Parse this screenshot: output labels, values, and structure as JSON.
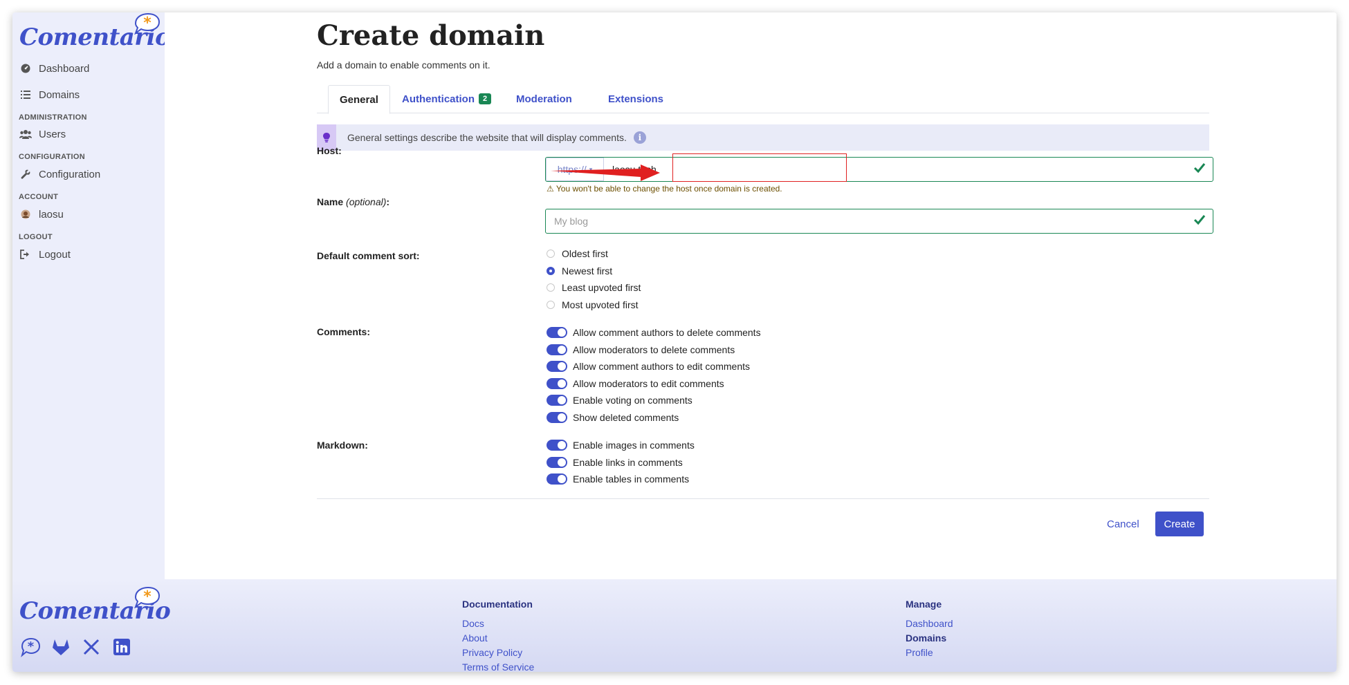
{
  "brand": {
    "name": "Comentario"
  },
  "sidebar": {
    "items": [
      {
        "label": "Dashboard",
        "icon": "dashboard-icon"
      },
      {
        "label": "Domains",
        "icon": "list-icon"
      }
    ],
    "sections": [
      {
        "title": "ADMINISTRATION",
        "items": [
          {
            "label": "Users",
            "icon": "users-icon"
          }
        ]
      },
      {
        "title": "CONFIGURATION",
        "items": [
          {
            "label": "Configuration",
            "icon": "wrench-icon"
          }
        ]
      },
      {
        "title": "ACCOUNT",
        "items": [
          {
            "label": "laosu",
            "icon": "avatar"
          }
        ]
      },
      {
        "title": "LOGOUT",
        "items": [
          {
            "label": "Logout",
            "icon": "sign-out-icon"
          }
        ]
      }
    ]
  },
  "page": {
    "title": "Create domain",
    "subtitle": "Add a domain to enable comments on it."
  },
  "tabs": [
    {
      "label": "General",
      "active": true
    },
    {
      "label": "Authentication",
      "badge": "2"
    },
    {
      "label": "Moderation"
    },
    {
      "label": "Extensions"
    }
  ],
  "info": {
    "text": "General settings describe the website that will display comments."
  },
  "form": {
    "host": {
      "label": "Host:",
      "protocol": "https://",
      "value": "laosu.tech",
      "warning": "You won't be able to change the host once domain is created."
    },
    "name": {
      "label": "Name",
      "label_optional": "(optional)",
      "label_suffix": ":",
      "placeholder": "My blog"
    },
    "sort": {
      "label": "Default comment sort:",
      "options": [
        "Oldest first",
        "Newest first",
        "Least upvoted first",
        "Most upvoted first"
      ],
      "selected": "Newest first"
    },
    "comments": {
      "label": "Comments:",
      "toggles": [
        "Allow comment authors to delete comments",
        "Allow moderators to delete comments",
        "Allow comment authors to edit comments",
        "Allow moderators to edit comments",
        "Enable voting on comments",
        "Show deleted comments"
      ]
    },
    "markdown": {
      "label": "Markdown:",
      "toggles": [
        "Enable images in comments",
        "Enable links in comments",
        "Enable tables in comments"
      ]
    }
  },
  "actions": {
    "cancel": "Cancel",
    "create": "Create"
  },
  "footer": {
    "documentation": {
      "title": "Documentation",
      "links": [
        "Docs",
        "About",
        "Privacy Policy",
        "Terms of Service"
      ]
    },
    "manage": {
      "title": "Manage",
      "links": [
        "Dashboard",
        "Domains",
        "Profile"
      ]
    }
  },
  "colors": {
    "accent": "#3f51c9",
    "success": "#198754",
    "sidebar_bg": "#eceefb",
    "annotation": "#e02020"
  }
}
